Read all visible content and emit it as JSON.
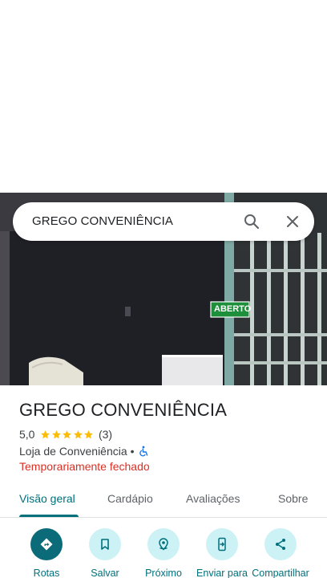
{
  "search": {
    "query": "GREGO CONVENIÊNCIA"
  },
  "photo": {
    "sign_text": "ABERTO"
  },
  "place": {
    "title": "GREGO CONVENIÊNCIA",
    "rating": "5,0",
    "rating_stars": 5,
    "review_count": "(3)",
    "category": "Loja de Conveniência",
    "separator": "•",
    "status": "Temporariamente fechado"
  },
  "tabs": [
    {
      "label": "Visão geral",
      "active": true
    },
    {
      "label": "Cardápio",
      "active": false
    },
    {
      "label": "Avaliações",
      "active": false
    },
    {
      "label": "Sobre",
      "active": false
    }
  ],
  "actions": [
    {
      "label": "Rotas",
      "icon": "directions-icon"
    },
    {
      "label": "Salvar",
      "icon": "bookmark-icon"
    },
    {
      "label": "Próximo",
      "icon": "nearby-icon"
    },
    {
      "label": "Enviar para",
      "icon": "send-to-phone-icon"
    },
    {
      "label": "Compartilhar",
      "icon": "share-icon"
    }
  ],
  "colors": {
    "accent": "#00707c",
    "primary_action": "#0b6b78",
    "action_bg": "#cdf2f5",
    "status_closed": "#d93025",
    "star": "#fbbc04"
  }
}
